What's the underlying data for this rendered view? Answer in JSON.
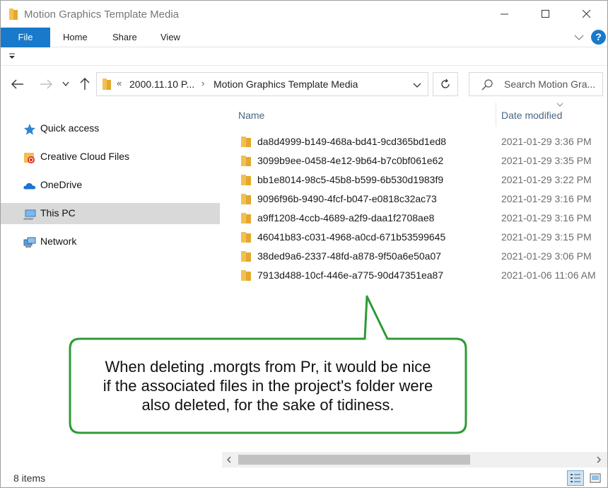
{
  "window": {
    "title": "Motion Graphics Template Media"
  },
  "ribbon": {
    "tabs": [
      "File",
      "Home",
      "Share",
      "View"
    ],
    "help_label": "?"
  },
  "address": {
    "overflow": "«",
    "crumbs": [
      "2000.11.10 P...",
      "Motion Graphics Template Media"
    ],
    "separator": "›"
  },
  "search": {
    "placeholder": "Search Motion Gra..."
  },
  "sidebar": {
    "items": [
      {
        "label": "Quick access",
        "icon": "star-icon"
      },
      {
        "label": "Creative Cloud Files",
        "icon": "creative-cloud-icon"
      },
      {
        "label": "OneDrive",
        "icon": "cloud-icon"
      },
      {
        "label": "This PC",
        "icon": "computer-icon",
        "selected": true
      },
      {
        "label": "Network",
        "icon": "network-icon"
      }
    ]
  },
  "columns": {
    "name": "Name",
    "date": "Date modified"
  },
  "files": [
    {
      "name": "da8d4999-b149-468a-bd41-9cd365bd1ed8",
      "date": "2021-01-29 3:36 PM"
    },
    {
      "name": "3099b9ee-0458-4e12-9b64-b7c0bf061e62",
      "date": "2021-01-29 3:35 PM"
    },
    {
      "name": "bb1e8014-98c5-45b8-b599-6b530d1983f9",
      "date": "2021-01-29 3:22 PM"
    },
    {
      "name": "9096f96b-9490-4fcf-b047-e0818c32ac73",
      "date": "2021-01-29 3:16 PM"
    },
    {
      "name": "a9ff1208-4ccb-4689-a2f9-daa1f2708ae8",
      "date": "2021-01-29 3:16 PM"
    },
    {
      "name": "46041b83-c031-4968-a0cd-671b53599645",
      "date": "2021-01-29 3:15 PM"
    },
    {
      "name": "38ded9a6-2337-48fd-a878-9f50a6e50a07",
      "date": "2021-01-29 3:06 PM"
    },
    {
      "name": "7913d488-10cf-446e-a775-90d47351ea87",
      "date": "2021-01-06 11:06 AM"
    }
  ],
  "callout": {
    "lines": [
      "When deleting .morgts from Pr, it would be nice",
      "if the associated files in the project's folder were",
      "also deleted, for the sake of tidiness."
    ]
  },
  "status": {
    "item_count": "8 items"
  },
  "colors": {
    "accent": "#1979ca",
    "folder": "#f3c04f",
    "callout_border": "#2e9a36",
    "selection": "#d9d9d9"
  }
}
